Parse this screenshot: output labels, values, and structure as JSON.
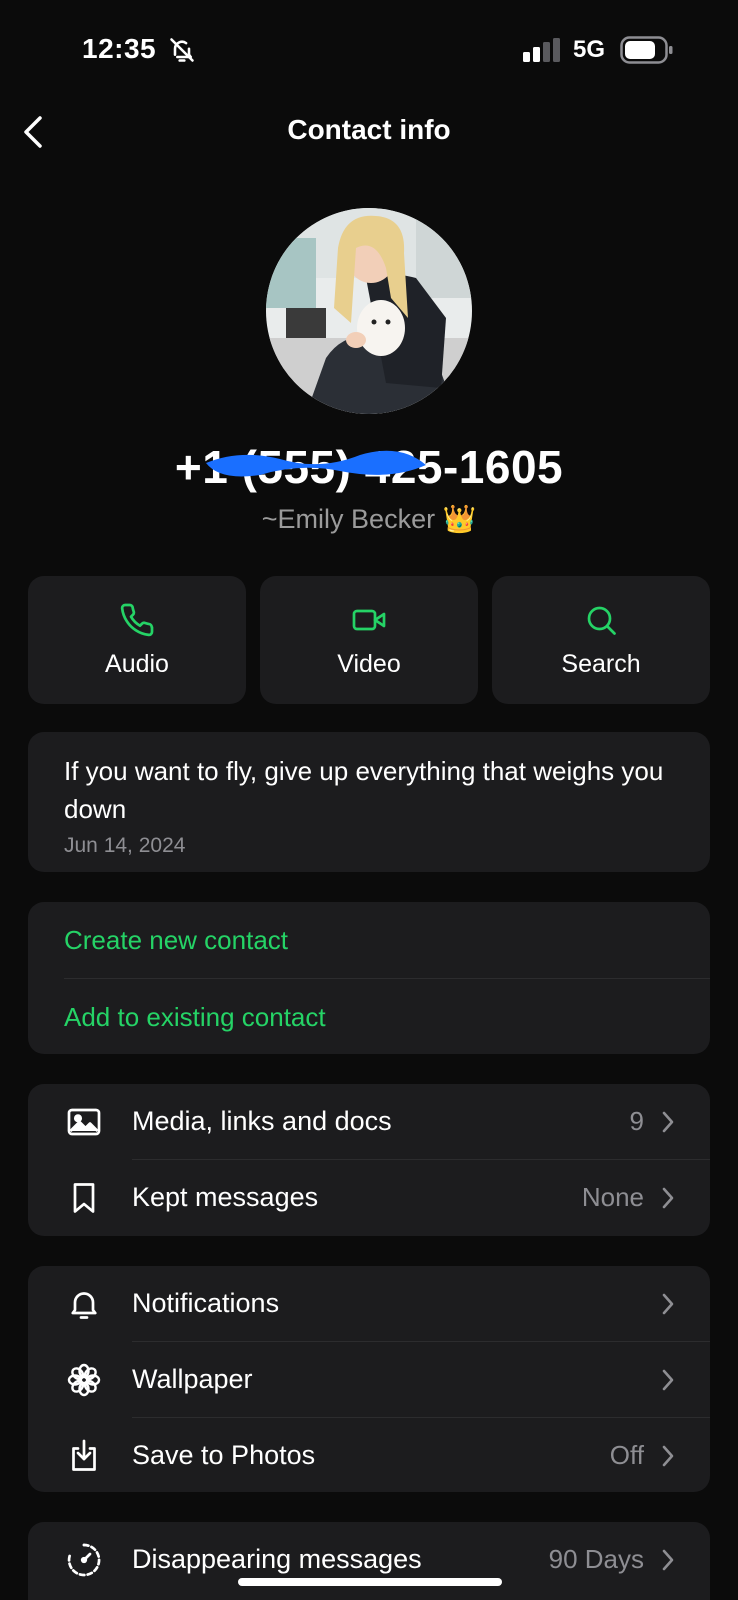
{
  "status_bar": {
    "time": "12:35",
    "network": "5G"
  },
  "nav": {
    "title": "Contact info"
  },
  "profile": {
    "phone_number": "+1 (555) 425-1605",
    "push_name": "~Emily Becker 👑"
  },
  "actions": [
    {
      "label": "Audio",
      "icon": "phone-icon"
    },
    {
      "label": "Video",
      "icon": "video-icon"
    },
    {
      "label": "Search",
      "icon": "search-icon"
    }
  ],
  "about": {
    "text": "If you want to fly, give up everything that weighs you down",
    "date": "Jun 14, 2024"
  },
  "contact_actions": {
    "create": "Create new contact",
    "add_existing": "Add to existing contact"
  },
  "media_section": [
    {
      "label": "Media, links and docs",
      "value": "9",
      "icon": "image-icon"
    },
    {
      "label": "Kept messages",
      "value": "None",
      "icon": "bookmark-icon"
    }
  ],
  "settings_section": [
    {
      "label": "Notifications",
      "value": "",
      "icon": "bell-icon"
    },
    {
      "label": "Wallpaper",
      "value": "",
      "icon": "flower-icon"
    },
    {
      "label": "Save to Photos",
      "value": "Off",
      "icon": "download-icon"
    }
  ],
  "disappearing": {
    "label": "Disappearing messages",
    "value": "90 Days",
    "icon": "timer-icon"
  },
  "colors": {
    "accent": "#25d366",
    "card": "#1c1c1e",
    "background": "#0b0b0b",
    "redaction": "#1a6fff"
  }
}
